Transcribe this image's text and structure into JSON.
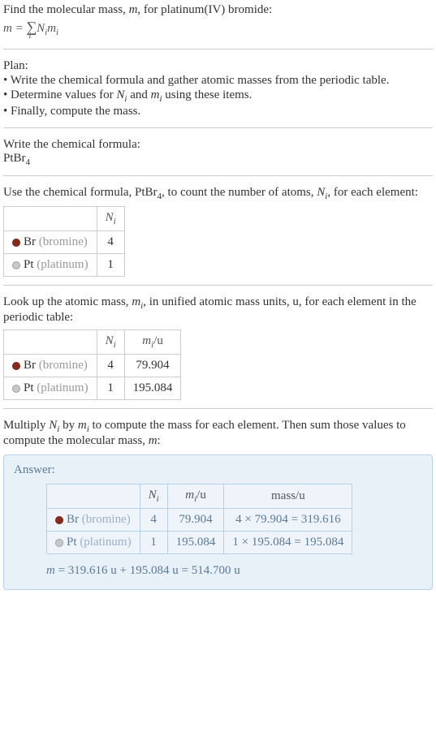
{
  "intro": {
    "line1_pre": "Find the molecular mass, ",
    "line1_var": "m",
    "line1_post": ", for platinum(IV) bromide:",
    "eq_lhs": "m",
    "eq_eq": " = ",
    "eq_sigma": "∑",
    "eq_under": "i",
    "eq_N": "N",
    "eq_i": "i",
    "eq_m": "m",
    "eq_i2": "i"
  },
  "plan": {
    "title": "Plan:",
    "b1_pre": "• Write the chemical formula and gather atomic masses from the periodic table.",
    "b2_pre": "• Determine values for ",
    "b2_N": "N",
    "b2_i": "i",
    "b2_and": " and ",
    "b2_m": "m",
    "b2_i2": "i",
    "b2_post": " using these items.",
    "b3": "• Finally, compute the mass."
  },
  "step1": {
    "title": "Write the chemical formula:",
    "formula_pt": "PtBr",
    "formula_sub": "4"
  },
  "step2": {
    "pre": "Use the chemical formula, PtBr",
    "sub": "4",
    "mid": ", to count the number of atoms, ",
    "N": "N",
    "i": "i",
    "post": ", for each element:",
    "hdr_N": "N",
    "hdr_i": "i",
    "rows": [
      {
        "dot": "#8b2a1a",
        "sym": "Br",
        "name": " (bromine)",
        "n": "4"
      },
      {
        "dot": "#c8c8c8",
        "sym": "Pt",
        "name": " (platinum)",
        "n": "1"
      }
    ]
  },
  "step3": {
    "pre": "Look up the atomic mass, ",
    "m": "m",
    "i": "i",
    "post": ", in unified atomic mass units, u, for each element in the periodic table:",
    "hdr_N": "N",
    "hdr_Ni": "i",
    "hdr_m": "m",
    "hdr_mi": "i",
    "hdr_u": "/u",
    "rows": [
      {
        "dot": "#8b2a1a",
        "sym": "Br",
        "name": " (bromine)",
        "n": "4",
        "mass": "79.904"
      },
      {
        "dot": "#c8c8c8",
        "sym": "Pt",
        "name": " (platinum)",
        "n": "1",
        "mass": "195.084"
      }
    ]
  },
  "step4": {
    "pre": "Multiply ",
    "N": "N",
    "i": "i",
    "by": " by ",
    "m": "m",
    "i2": "i",
    "mid": " to compute the mass for each element. Then sum those values to compute the molecular mass, ",
    "mv": "m",
    "post": ":"
  },
  "answer": {
    "label": "Answer:",
    "hdr_N": "N",
    "hdr_Ni": "i",
    "hdr_m": "m",
    "hdr_mi": "i",
    "hdr_u": "/u",
    "hdr_mass": "mass/u",
    "rows": [
      {
        "dot": "#8b2a1a",
        "sym": "Br",
        "name": " (bromine)",
        "n": "4",
        "mass": "79.904",
        "calc": "4 × 79.904 = 319.616"
      },
      {
        "dot": "#c8c8c8",
        "sym": "Pt",
        "name": " (platinum)",
        "n": "1",
        "mass": "195.084",
        "calc": "1 × 195.084 = 195.084"
      }
    ],
    "final_m": "m",
    "final_eq": " = 319.616 u + 195.084 u = 514.700 u"
  }
}
